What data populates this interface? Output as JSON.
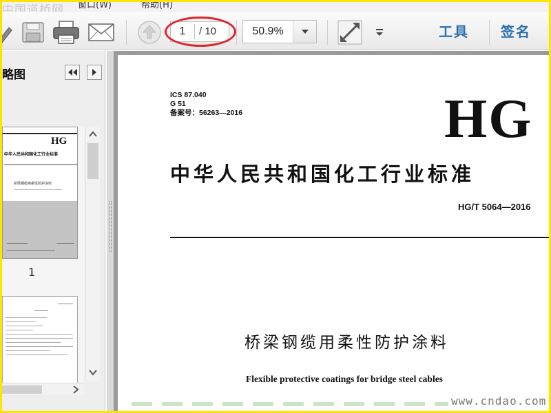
{
  "app": {
    "site_mark": "中国道桥网",
    "watermark": "www.cndao.com",
    "accent_color": "#2a6fb0",
    "frame_color": "#ffe400",
    "highlight_color": "#e0242c"
  },
  "menu": {
    "window": "窗口(W)",
    "help": "帮助(H)"
  },
  "toolbar": {
    "icons": [
      "pencil-icon",
      "save-icon",
      "print-icon",
      "email-icon",
      "previous-page-icon",
      "fit-window-icon",
      "more-options-icon"
    ],
    "page_current": "1",
    "page_total": "/ 10",
    "zoom": "50.9%",
    "tools_label": "工具",
    "sign_label": "签名"
  },
  "sidebar": {
    "title": "略图",
    "thumbnails": [
      {
        "label": "1",
        "hg": "HG",
        "cn_title": "中华人民共和国化工行业标准",
        "name_cn": "桥梁钢缆用柔性防护涂料"
      }
    ]
  },
  "document": {
    "meta_lines": [
      "ICS 87.040",
      "G 51",
      "备案号：56263—2016"
    ],
    "hg_mark": "HG",
    "cn_title": "中华人民共和国化工行业标准",
    "code": "HG/T 5064—2016",
    "name_cn": "桥梁钢缆用柔性防护涂料",
    "name_en": "Flexible protective coatings for bridge steel cables"
  }
}
